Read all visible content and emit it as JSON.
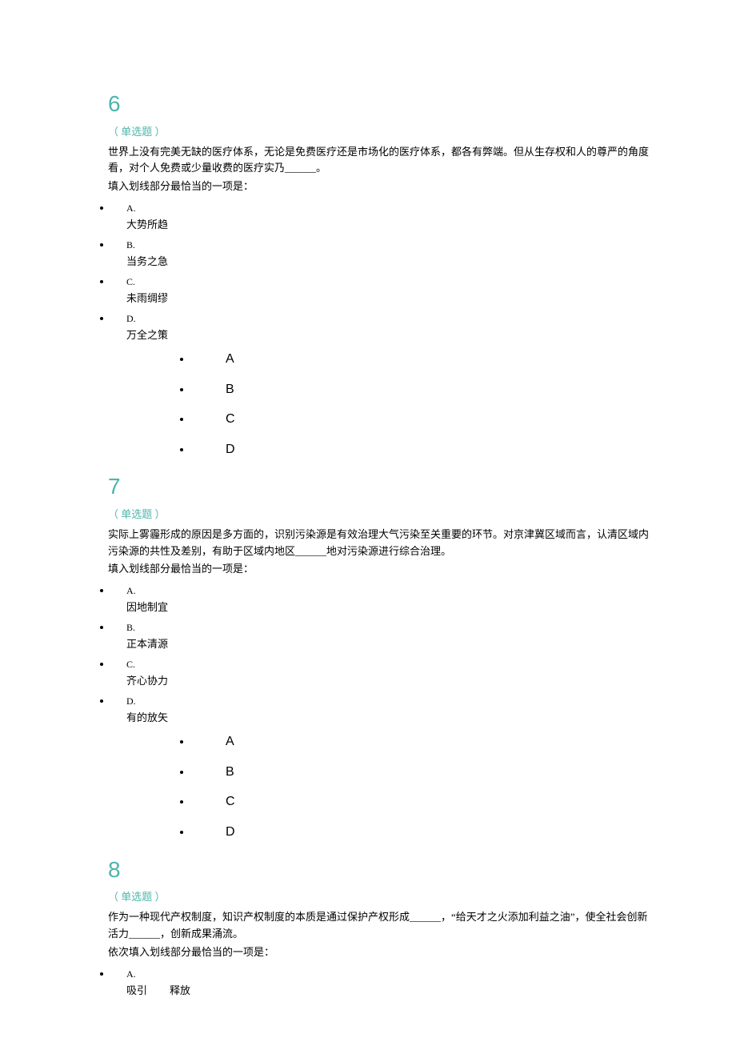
{
  "questions": [
    {
      "number": "6",
      "type_label": "（ 单选题 ）",
      "stem": "世界上没有完美无缺的医疗体系，无论是免费医疗还是市场化的医疗体系，都各有弊端。但从生存权和人的尊严的角度看，对个人免费或少量收费的医疗实乃______。",
      "prompt": "填入划线部分最恰当的一项是：",
      "options": [
        {
          "letter": "A.",
          "text": "大势所趋"
        },
        {
          "letter": "B.",
          "text": "当务之急"
        },
        {
          "letter": "C.",
          "text": "未雨绸缪"
        },
        {
          "letter": "D.",
          "text": "万全之策"
        }
      ],
      "answers": [
        "A",
        "B",
        "C",
        "D"
      ]
    },
    {
      "number": "7",
      "type_label": "（ 单选题 ）",
      "stem": "实际上雾霾形成的原因是多方面的，识别污染源是有效治理大气污染至关重要的环节。对京津冀区域而言，认清区域内污染源的共性及差别，有助于区域内地区______地对污染源进行综合治理。",
      "prompt": "填入划线部分最恰当的一项是：",
      "options": [
        {
          "letter": "A.",
          "text": "因地制宜"
        },
        {
          "letter": "B.",
          "text": "正本清源"
        },
        {
          "letter": "C.",
          "text": "齐心协力"
        },
        {
          "letter": "D.",
          "text": "有的放矢"
        }
      ],
      "answers": [
        "A",
        "B",
        "C",
        "D"
      ]
    },
    {
      "number": "8",
      "type_label": "（ 单选题 ）",
      "stem": "作为一种现代产权制度，知识产权制度的本质是通过保护产权形成______，“给天才之火添加利益之油”，使全社会创新活力______，创新成果涌流。",
      "prompt": "依次填入划线部分最恰当的一项是：",
      "options": [
        {
          "letter": "A.",
          "text_parts": [
            "吸引",
            "释放"
          ]
        }
      ],
      "answers": []
    }
  ]
}
